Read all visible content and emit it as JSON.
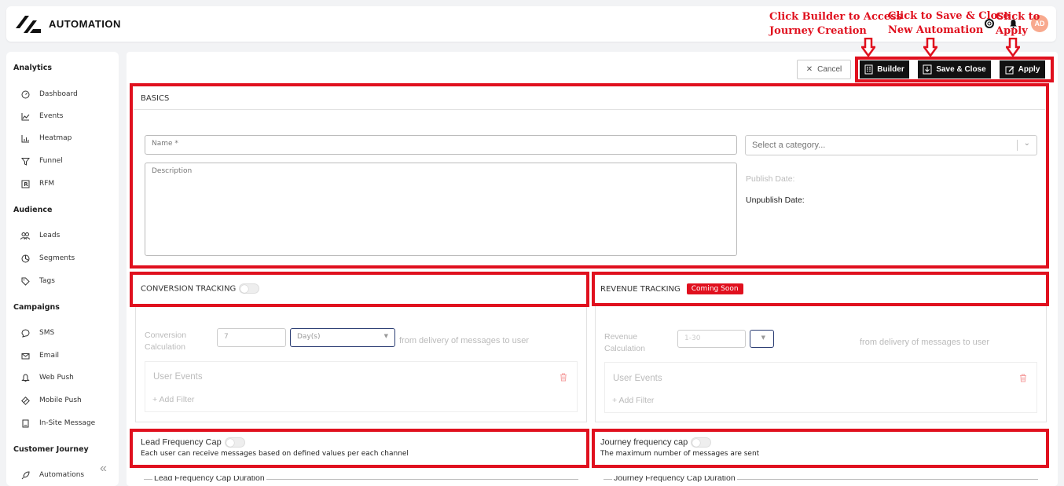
{
  "app": {
    "title": "AUTOMATION",
    "avatar_initials": "AD"
  },
  "colors": {
    "annotation_red": "#e0101e",
    "button_dark": "#111111",
    "badge_red": "#e0101e"
  },
  "header_icons": [
    "help-lifebuoy-icon",
    "bell-icon"
  ],
  "sidebar": {
    "sections": [
      {
        "title": "Analytics",
        "items": [
          {
            "label": "Dashboard",
            "icon": "dashboard-gauge-icon"
          },
          {
            "label": "Events",
            "icon": "line-chart-icon"
          },
          {
            "label": "Heatmap",
            "icon": "bar-chart-icon"
          },
          {
            "label": "Funnel",
            "icon": "funnel-icon"
          },
          {
            "label": "RFM",
            "icon": "rfm-box-icon"
          }
        ]
      },
      {
        "title": "Audience",
        "items": [
          {
            "label": "Leads",
            "icon": "users-icon"
          },
          {
            "label": "Segments",
            "icon": "pie-chart-icon"
          },
          {
            "label": "Tags",
            "icon": "tag-icon"
          }
        ]
      },
      {
        "title": "Campaigns",
        "items": [
          {
            "label": "SMS",
            "icon": "chat-bubble-icon"
          },
          {
            "label": "Email",
            "icon": "envelope-icon"
          },
          {
            "label": "Web Push",
            "icon": "bell-outline-icon"
          },
          {
            "label": "Mobile Push",
            "icon": "mobile-push-icon"
          },
          {
            "label": "In-Site Message",
            "icon": "document-icon"
          }
        ]
      },
      {
        "title": "Customer Journey",
        "items": [
          {
            "label": "Automations",
            "icon": "rocket-icon"
          }
        ]
      }
    ]
  },
  "toolbar": {
    "cancel_label": "Cancel",
    "builder_label": "Builder",
    "save_close_label": "Save & Close",
    "apply_label": "Apply"
  },
  "annotations": {
    "builder_line1": "Click Builder to Access",
    "builder_line2": "Journey Creation",
    "save_line1": "Click to Save & Close",
    "save_line2": "New Automation",
    "apply_line1": "Click to Apply"
  },
  "basics": {
    "title": "BASICS",
    "name_placeholder": "Name *",
    "description_placeholder": "Description",
    "category_placeholder": "Select a category...",
    "publish_date_label": "Publish Date:",
    "unpublish_date_label": "Unpublish Date:"
  },
  "conversion": {
    "title": "CONVERSION TRACKING",
    "calc_label_1": "Conversion",
    "calc_label_2": "Calculation",
    "value": "7",
    "unit": "Day(s)",
    "suffix": "from delivery of messages to user",
    "user_events": "User Events",
    "add_filter": "+ Add Filter"
  },
  "revenue": {
    "title": "REVENUE TRACKING",
    "badge": "Coming Soon",
    "calc_label_1": "Revenue",
    "calc_label_2": "Calculation",
    "placeholder": "1-30",
    "suffix": "from delivery of messages to user",
    "user_events": "User Events",
    "add_filter": "+ Add Filter"
  },
  "lead_cap": {
    "title": "Lead Frequency Cap",
    "description": "Each user can receive messages based on defined values per each channel",
    "duration_label": "Lead Frequency Cap Duration"
  },
  "journey_cap": {
    "title": "Journey frequency cap",
    "description": "The maximum number of messages are sent",
    "duration_label": "Journey Frequency Cap Duration"
  }
}
